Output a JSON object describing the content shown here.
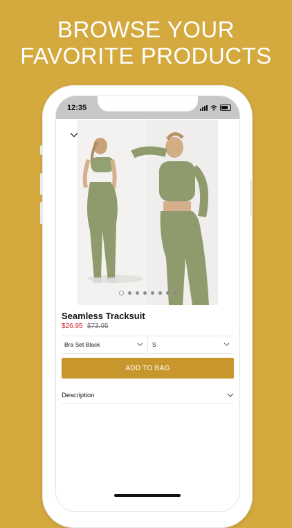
{
  "headline": {
    "line1": "BROWSE YOUR",
    "line2": "FAVORITE PRODUCTS"
  },
  "status_bar": {
    "time": "12:35"
  },
  "product": {
    "title": "Seamless Tracksuit",
    "sale_price": "$26.95",
    "original_price": "$73.95",
    "image_count": 8,
    "active_image": 1
  },
  "options": {
    "style_value": "Bra Set Black",
    "size_value": "S"
  },
  "actions": {
    "add_to_bag_label": "ADD TO BAG"
  },
  "sections": {
    "description_label": "Description"
  },
  "colors": {
    "background": "#D4A93E",
    "button": "#C7972D",
    "sale_price": "#d0262b",
    "outfit": "#8f9b6c"
  },
  "icons": {
    "close": "chevron-down-icon",
    "dropdown": "chevron-down-icon"
  }
}
